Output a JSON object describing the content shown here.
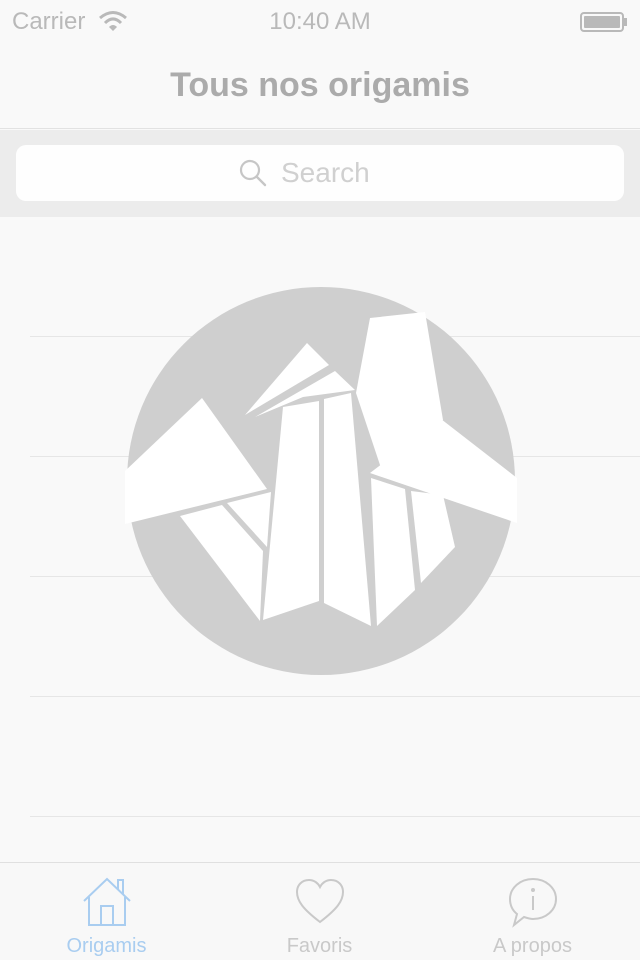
{
  "status_bar": {
    "carrier": "Carrier",
    "time": "10:40 AM",
    "wifi_icon": "wifi-icon",
    "battery_icon": "battery-icon"
  },
  "nav": {
    "title": "Tous nos origamis"
  },
  "search": {
    "placeholder": "Search",
    "icon": "search-icon"
  },
  "empty_state": {
    "logo": "origami-crane-logo"
  },
  "tabs": [
    {
      "label": "Origamis",
      "icon": "house-icon",
      "active": true
    },
    {
      "label": "Favoris",
      "icon": "heart-icon",
      "active": false
    },
    {
      "label": "A propos",
      "icon": "info-bubble-icon",
      "active": false
    }
  ],
  "colors": {
    "background": "#f9f9f9",
    "search_bar_bg": "#ececec",
    "title_text": "#ababab",
    "active_tab": "#a9cdf0",
    "inactive_tab": "#c9c9c9",
    "logo_circle": "#cfcfcf"
  }
}
